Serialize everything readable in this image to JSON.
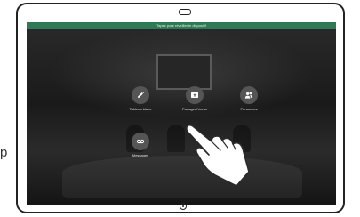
{
  "status_bar": {
    "text": "Tapez pour réveiller le dispositif"
  },
  "actions": [
    {
      "label": "Tableau blanc",
      "icon": "pencil-icon"
    },
    {
      "label": "Partager l'écran",
      "icon": "share-screen-icon"
    },
    {
      "label": "Personnes",
      "icon": "people-icon"
    },
    {
      "label": "Messages",
      "icon": "voicemail-icon"
    }
  ],
  "outside_text": "p",
  "colors": {
    "status_bar": "#2f7a56",
    "button_circle": "#555555",
    "label_text": "#e8e8e8",
    "bezel": "#222222"
  }
}
